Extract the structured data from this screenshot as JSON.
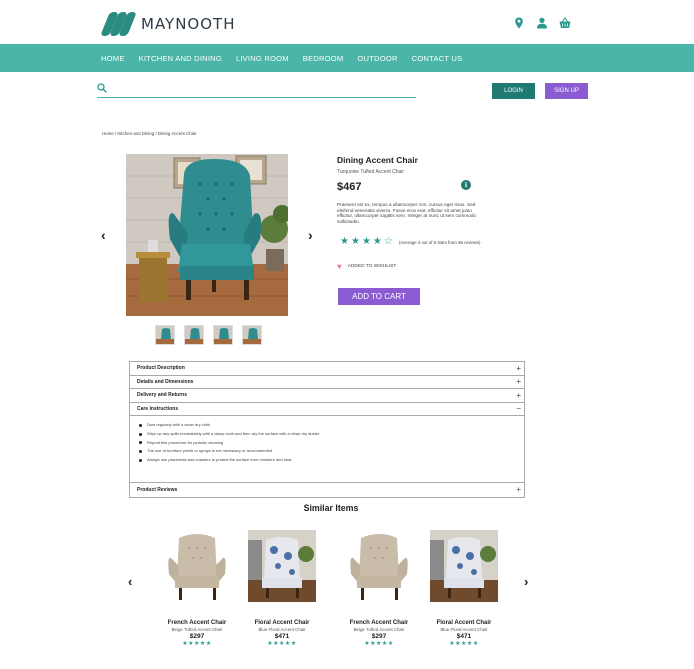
{
  "brand": {
    "name": "MAYNOOTH",
    "color": "#2a8c80"
  },
  "header_icons": [
    "location-icon",
    "user-icon",
    "basket-icon"
  ],
  "nav": {
    "items": [
      "HOME",
      "KITCHEN AND DINING",
      "LIVING ROOM",
      "BEDROOM",
      "OUTDOOR",
      "CONTACT US"
    ],
    "color": "#4ab5a8"
  },
  "search": {
    "placeholder": "",
    "value": ""
  },
  "auth": {
    "login": "LOGIN",
    "signup": "SIGN UP"
  },
  "breadcrumb": "Home / Kitchen and Dining / Dining Accent Chair",
  "product": {
    "title": "Dining Accent Chair",
    "subtitle": "Turquoise Tufted Accent Chair",
    "price": "$467",
    "info_icon_label": "i",
    "description": "Praesent est ex, tempus a ullamcorper non, cursus eget risus. Sed eleifend venenatis viverra. Fusce eros erat, efficitur sit amet justo efficitur, ullamcorper sagittis sem. Integer at nunc ut sem commodo sollicitudin.",
    "rating_value": 4,
    "rating_max": 5,
    "rating_text": "(Average 4 out of 5 stars from 56 reviews)",
    "wishlist_text": "ADDED TO WISHLIST",
    "add_to_cart": "ADD TO CART",
    "thumbnail_count": 4
  },
  "accordion": {
    "sections": [
      "Product Description",
      "Details and Dimensions",
      "Delivery and Returns",
      "Care Instructions",
      "Product Reviews"
    ],
    "care_instructions": [
      "Dust regularly with a clean dry cloth",
      "Wipe up any spills immediately with a damp cloth and then dry the surface with a clean dry duster",
      "Repeat this procedure for periodic cleaning",
      "The use of furniture polish or sprays is not necessary or recommended",
      "Always use placemats and coasters to protect the surface from moisture and heat"
    ]
  },
  "similar": {
    "title": "Similar Items",
    "items": [
      {
        "name": "French Accent Chair",
        "sub": "Beige Tufted Accent Chair",
        "price": "$297",
        "stars": "★★★★★"
      },
      {
        "name": "Floral Accent Chair",
        "sub": "Blue Floral Accent Chair",
        "price": "$471",
        "stars": "★★★★★"
      },
      {
        "name": "French Accent Chair",
        "sub": "Beige Tufted Accent Chair",
        "price": "$297",
        "stars": "★★★★★"
      },
      {
        "name": "Floral Accent Chair",
        "sub": "Blue Floral Accent Chair",
        "price": "$471",
        "stars": "★★★★★"
      }
    ]
  },
  "colors": {
    "teal_dark": "#1f7a72",
    "purple": "#8a5bd1",
    "star": "#2a9a8e",
    "heart": "#e279a4"
  }
}
